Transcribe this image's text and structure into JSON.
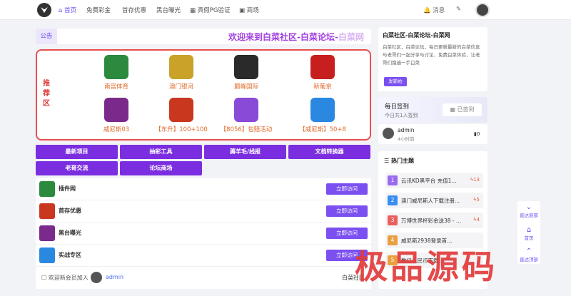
{
  "nav": {
    "items": [
      "首页",
      "免费彩金",
      "首存优惠",
      "黑台曝光",
      "真假PG验证",
      "商场"
    ],
    "messages": "消息"
  },
  "notice": {
    "tag": "公告",
    "text": "欢迎来到白菜社区-白菜论坛-",
    "text_fade": "白菜网"
  },
  "recommend": {
    "label": "推荐区",
    "items": [
      {
        "name": "南宫体育",
        "color": "#2b8a3e"
      },
      {
        "name": "澳门银河",
        "color": "#c9a227"
      },
      {
        "name": "巅峰国际",
        "color": "#2a2a2a"
      },
      {
        "name": "新葡京",
        "color": "#c71f1f"
      },
      {
        "name": "威尼斯03",
        "color": "#7a2a8a"
      },
      {
        "name": "【东升】100+100",
        "color": "#c9371f"
      },
      {
        "name": "【8056】包赔活动",
        "color": "#8a4ad8"
      },
      {
        "name": "【威尼斯】50+8",
        "color": "#2a88e0"
      }
    ]
  },
  "categories": [
    "最新项目",
    "抽彩工具",
    "薅羊毛/线报",
    "文档转换器",
    "老哥交流",
    "论坛商场"
  ],
  "sites": [
    {
      "name": "插件网",
      "button": "立即访问",
      "color": "#2b8a3e"
    },
    {
      "name": "首存优惠",
      "button": "立即访问",
      "color": "#c9371f"
    },
    {
      "name": "黑台曝光",
      "button": "立即访问",
      "color": "#7a2a8a"
    },
    {
      "name": "实战专区",
      "button": "立即访问",
      "color": "#2a88e0"
    }
  ],
  "new_member": {
    "label": "欢迎新会员加入",
    "name": "admin"
  },
  "footer_text": "白菜社区",
  "intro": {
    "title": "白菜社区-白菜论坛-白菜网",
    "desc": "白菜社区，白菜论坛，每日更新最新的白菜信息与老哥们一起分享与讨论，免费白菜体验，让老哥们撸遍一手白菜",
    "button": "发新帖"
  },
  "checkin": {
    "title": "每日签到",
    "sub": "今日共1人签到",
    "button": "已签到"
  },
  "admin": {
    "name": "admin",
    "time": "4小时前",
    "count": "0"
  },
  "hot": {
    "title": "热门主题",
    "items": [
      {
        "num": "1",
        "text": "云讯KD黑平台 充值1...",
        "count": "13",
        "color": "#9b6af0"
      },
      {
        "num": "2",
        "text": "澳门威尼斯人下载注册...",
        "count": "5",
        "color": "#3a8ef0"
      },
      {
        "num": "3",
        "text": "万博世界杯彩金送38 - ...",
        "count": "4",
        "color": "#e86060"
      },
      {
        "num": "4",
        "text": "威尼斯2938登录首...",
        "count": "",
        "color": "#e8a040"
      },
      {
        "num": "5",
        "text": "数亿人民币下载...",
        "count": "",
        "color": "#e8a040"
      }
    ]
  },
  "side_tools": {
    "to_top": "直达底部",
    "home": "首页",
    "bottom": "直达顶部"
  },
  "watermark": "极品源码"
}
